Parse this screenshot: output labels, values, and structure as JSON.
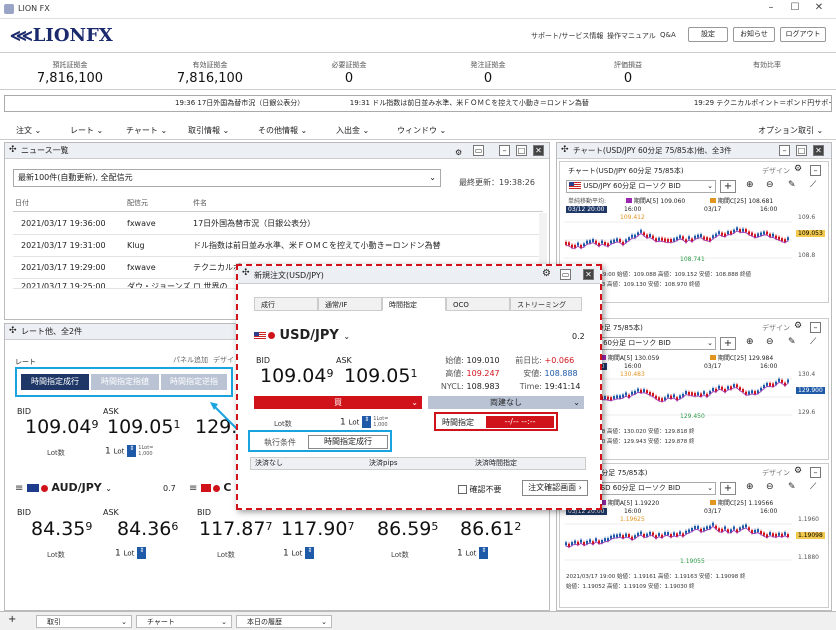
{
  "window": {
    "title": "LION FX"
  },
  "header": {
    "logo": "LIONFX",
    "links": [
      "サポート/サービス情報",
      "操作マニュアル",
      "Q&A"
    ],
    "buttons": [
      "設定",
      "お知らせ",
      "ログアウト"
    ]
  },
  "summary": [
    {
      "label": "預託証拠金",
      "value": "7,816,100"
    },
    {
      "label": "有効証拠金",
      "value": "7,816,100"
    },
    {
      "label": "必要証拠金",
      "value": "0"
    },
    {
      "label": "発注証拠金",
      "value": "0"
    },
    {
      "label": "評価損益",
      "value": "0"
    },
    {
      "label": "有効比率",
      "value": ""
    }
  ],
  "ticker": "19:36  17日外国為替市況（日銀公表分）　　　　　　　19:31  ドル指数は前日並み水準、米ＦＯＭＣを控えて小動き＝ロンドン為替　　　　　　　　　　　　　　　19:29  テクニカルポイント＝ポンド円サポート1  150.80 （一目",
  "menu": [
    "注文",
    "レート",
    "チャート",
    "取引情報",
    "その他情報",
    "入出金",
    "ウィンドウ"
  ],
  "menu_right": "オプション取引",
  "news": {
    "title": "ニュース一覧",
    "filter": "最新100件(自動更新), 全配信元",
    "updated": "最終更新：19:38:26",
    "cols": [
      "日付",
      "配信元",
      "件名"
    ],
    "rows": [
      {
        "date": "2021/03/17 19:36:00",
        "src": "fxwave",
        "subj": "17日外国為替市況（日銀公表分）"
      },
      {
        "date": "2021/03/17 19:31:00",
        "src": "Klug",
        "subj": "ドル指数は前日並み水準、米ＦＯＭＣを控えて小動き＝ロンドン為替"
      },
      {
        "date": "2021/03/17 19:29:00",
        "src": "fxwave",
        "subj": "テクニカルポ"
      },
      {
        "date": "2021/03/17 19:25:00",
        "src": "ダウ・ジョーンズ",
        "subj": "ロ 世界の"
      }
    ]
  },
  "rate_panel": {
    "title": "レート他、全2件",
    "rate_label": "レート",
    "panel_add": "パネル追加",
    "design": "デザイ",
    "order_buttons": [
      "時間指定成行",
      "時間指定指値",
      "時間指定逆指"
    ],
    "bid": "BID",
    "ask": "ASK",
    "lot_label": "Lot数",
    "lot_value": "1",
    "lot_unit": "Lot",
    "lot_note": "1Lot=\n1,000",
    "usd_bid_main": "109.04",
    "usd_bid_sup": "9",
    "usd_ask_main": "109.05",
    "usd_ask_sup": "1",
    "col3_bid": "129.9",
    "aud": {
      "pair": "AUD/JPY",
      "spread": "0.7",
      "bid_main": "84.35",
      "bid_sup": "9",
      "ask_main": "84.36",
      "ask_sup": "6"
    },
    "chf": {
      "pair": "C",
      "bid_main": "117.87",
      "bid_sup": "7",
      "ask_main": "117.90",
      "ask_sup": "7"
    },
    "col3": {
      "bid_main": "86.59",
      "bid_sup": "5",
      "ask_main": "86.61",
      "ask_sup": "2"
    },
    "lot_text": "1,000"
  },
  "chart_panel": {
    "title": "チャート(USD/JPY 60分足 75/85本)他、全3件",
    "design": "デザイン",
    "charts": [
      {
        "sub": "チャート(USD/JPY 60分足 75/85本)",
        "pair": "USD/JPY 60分足 ローソク BID",
        "ind": "単純移動平均:",
        "ma5": "期間A[5] 109.060",
        "ma25": "期間C[25] 108.681",
        "d1": "03/12 20:00",
        "t1": "16:00",
        "d2": "03/17",
        "t2": "16:00",
        "hi": "109.412",
        "lo": "108.741",
        "last": "109.053",
        "axis": [
          "109.6",
          "109.2",
          "108.8"
        ],
        "ohlc": "2021/03/17 19:00 始値：109.088 高値：109.152 安値：108.888 終値",
        "ohlc2": "始値：109.083 高値：109.130 安値：108.970 終値"
      },
      {
        "sub": "R/JPY 60分足 75/85本)",
        "pair": "R/JPY 60分足 ローソク BID",
        "ma5": "期間A[5] 130.059",
        "ma25": "期間C[25] 129.984",
        "d1": "03/12 20:00",
        "t1": "16:00",
        "d2": "03/17",
        "t2": "16:00",
        "hi": "130.483",
        "lo": "129.450",
        "last": "129.900",
        "axis": [
          "130.4",
          "130.0",
          "129.6"
        ],
        "ohlc": "始値：129.858 高値：130.020 安値：129.818 終",
        "ohlc2": "始値：129.940 高値：129.943 安値：129.878 終"
      },
      {
        "sub": "R/USD 60分足 75/85本)",
        "pair": "UR/USD 60分足 ローソク BID",
        "ma5": "期間A[5] 1.19220",
        "ma25": "期間C[25] 1.19566",
        "d1": "03/12 20:00",
        "t1": "16:00",
        "d2": "03/17",
        "t2": "16:00",
        "hi": "1.19625",
        "hi2": "1.19473",
        "hi3": "1.19121",
        "lo": "1.19055",
        "lo2": "1.19067",
        "lo3": "1.18762",
        "last": "1.19098",
        "axis": [
          "1.1960",
          "1.1920",
          "1.1880"
        ],
        "ohlc": "2021/03/17 19:00 始値：1.19161 高値：1.19163 安値：1.19098 終",
        "ohlc2": "始値：1.19052 高値：1.19109 安値：1.19030 終"
      }
    ]
  },
  "dialog": {
    "title": "新規注文(USD/JPY)",
    "tabs": [
      "成行",
      "通常/IF",
      "時間指定",
      "OCO",
      "ストリーミング"
    ],
    "pair": "USD/JPY",
    "spread": "0.2",
    "bid": "BID",
    "ask": "ASK",
    "bid_main": "109.04",
    "bid_sup": "9",
    "ask_main": "109.05",
    "ask_sup": "1",
    "open_lbl": "始値:",
    "open_val": "109.010",
    "prev_lbl": "前日比:",
    "prev_val": "+0.066",
    "high_lbl": "高値:",
    "high_val": "109.247",
    "low_lbl": "安値:",
    "low_val": "108.888",
    "nycl_lbl": "NYCL:",
    "nycl_val": "108.983",
    "time_lbl": "Time:",
    "time_val": "19:41:14",
    "side": "買",
    "side2": "両建なし",
    "lot_label": "Lot数",
    "lot_value": "1",
    "lot_unit": "Lot",
    "lot_note": "1Lot=\n1,000",
    "exec_label": "執行条件",
    "exec_value": "時間指定成行",
    "time_label": "時間指定",
    "time_value": "--/-- --:--",
    "settle": [
      "決済なし",
      "決済pips",
      "決済時間指定"
    ],
    "confirm_skip": "確認不要",
    "confirm_btn": "注文確認画面"
  },
  "bottom_tabs": [
    "取引",
    "チャート",
    "本日の履歴"
  ]
}
